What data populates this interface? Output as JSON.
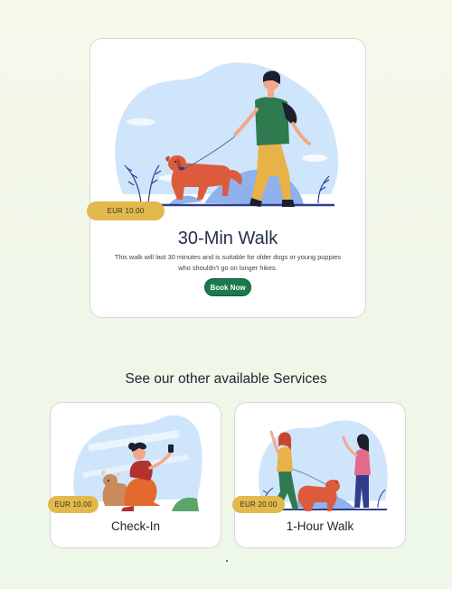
{
  "featured": {
    "price": "EUR 10.00",
    "title": "30-Min Walk",
    "description_line1": "This walk will last 30 minutes and is suitable for older dogs or young puppies",
    "description_line2": "who shouldn't go on longer hikes.",
    "cta_label": "Book Now",
    "illustration": "man-walking-dog"
  },
  "services_heading": "See our other available Services",
  "services": [
    {
      "price": "EUR 10.00",
      "title": "Check-In",
      "illustration": "woman-selfie-with-dog"
    },
    {
      "price": "EUR 20.00",
      "title": "1-Hour Walk",
      "illustration": "two-women-walking-dog"
    }
  ],
  "colors": {
    "accent_green": "#1a7a4d",
    "price_tag": "#e2b94c",
    "illustration_blue": "#cfe5fb"
  }
}
